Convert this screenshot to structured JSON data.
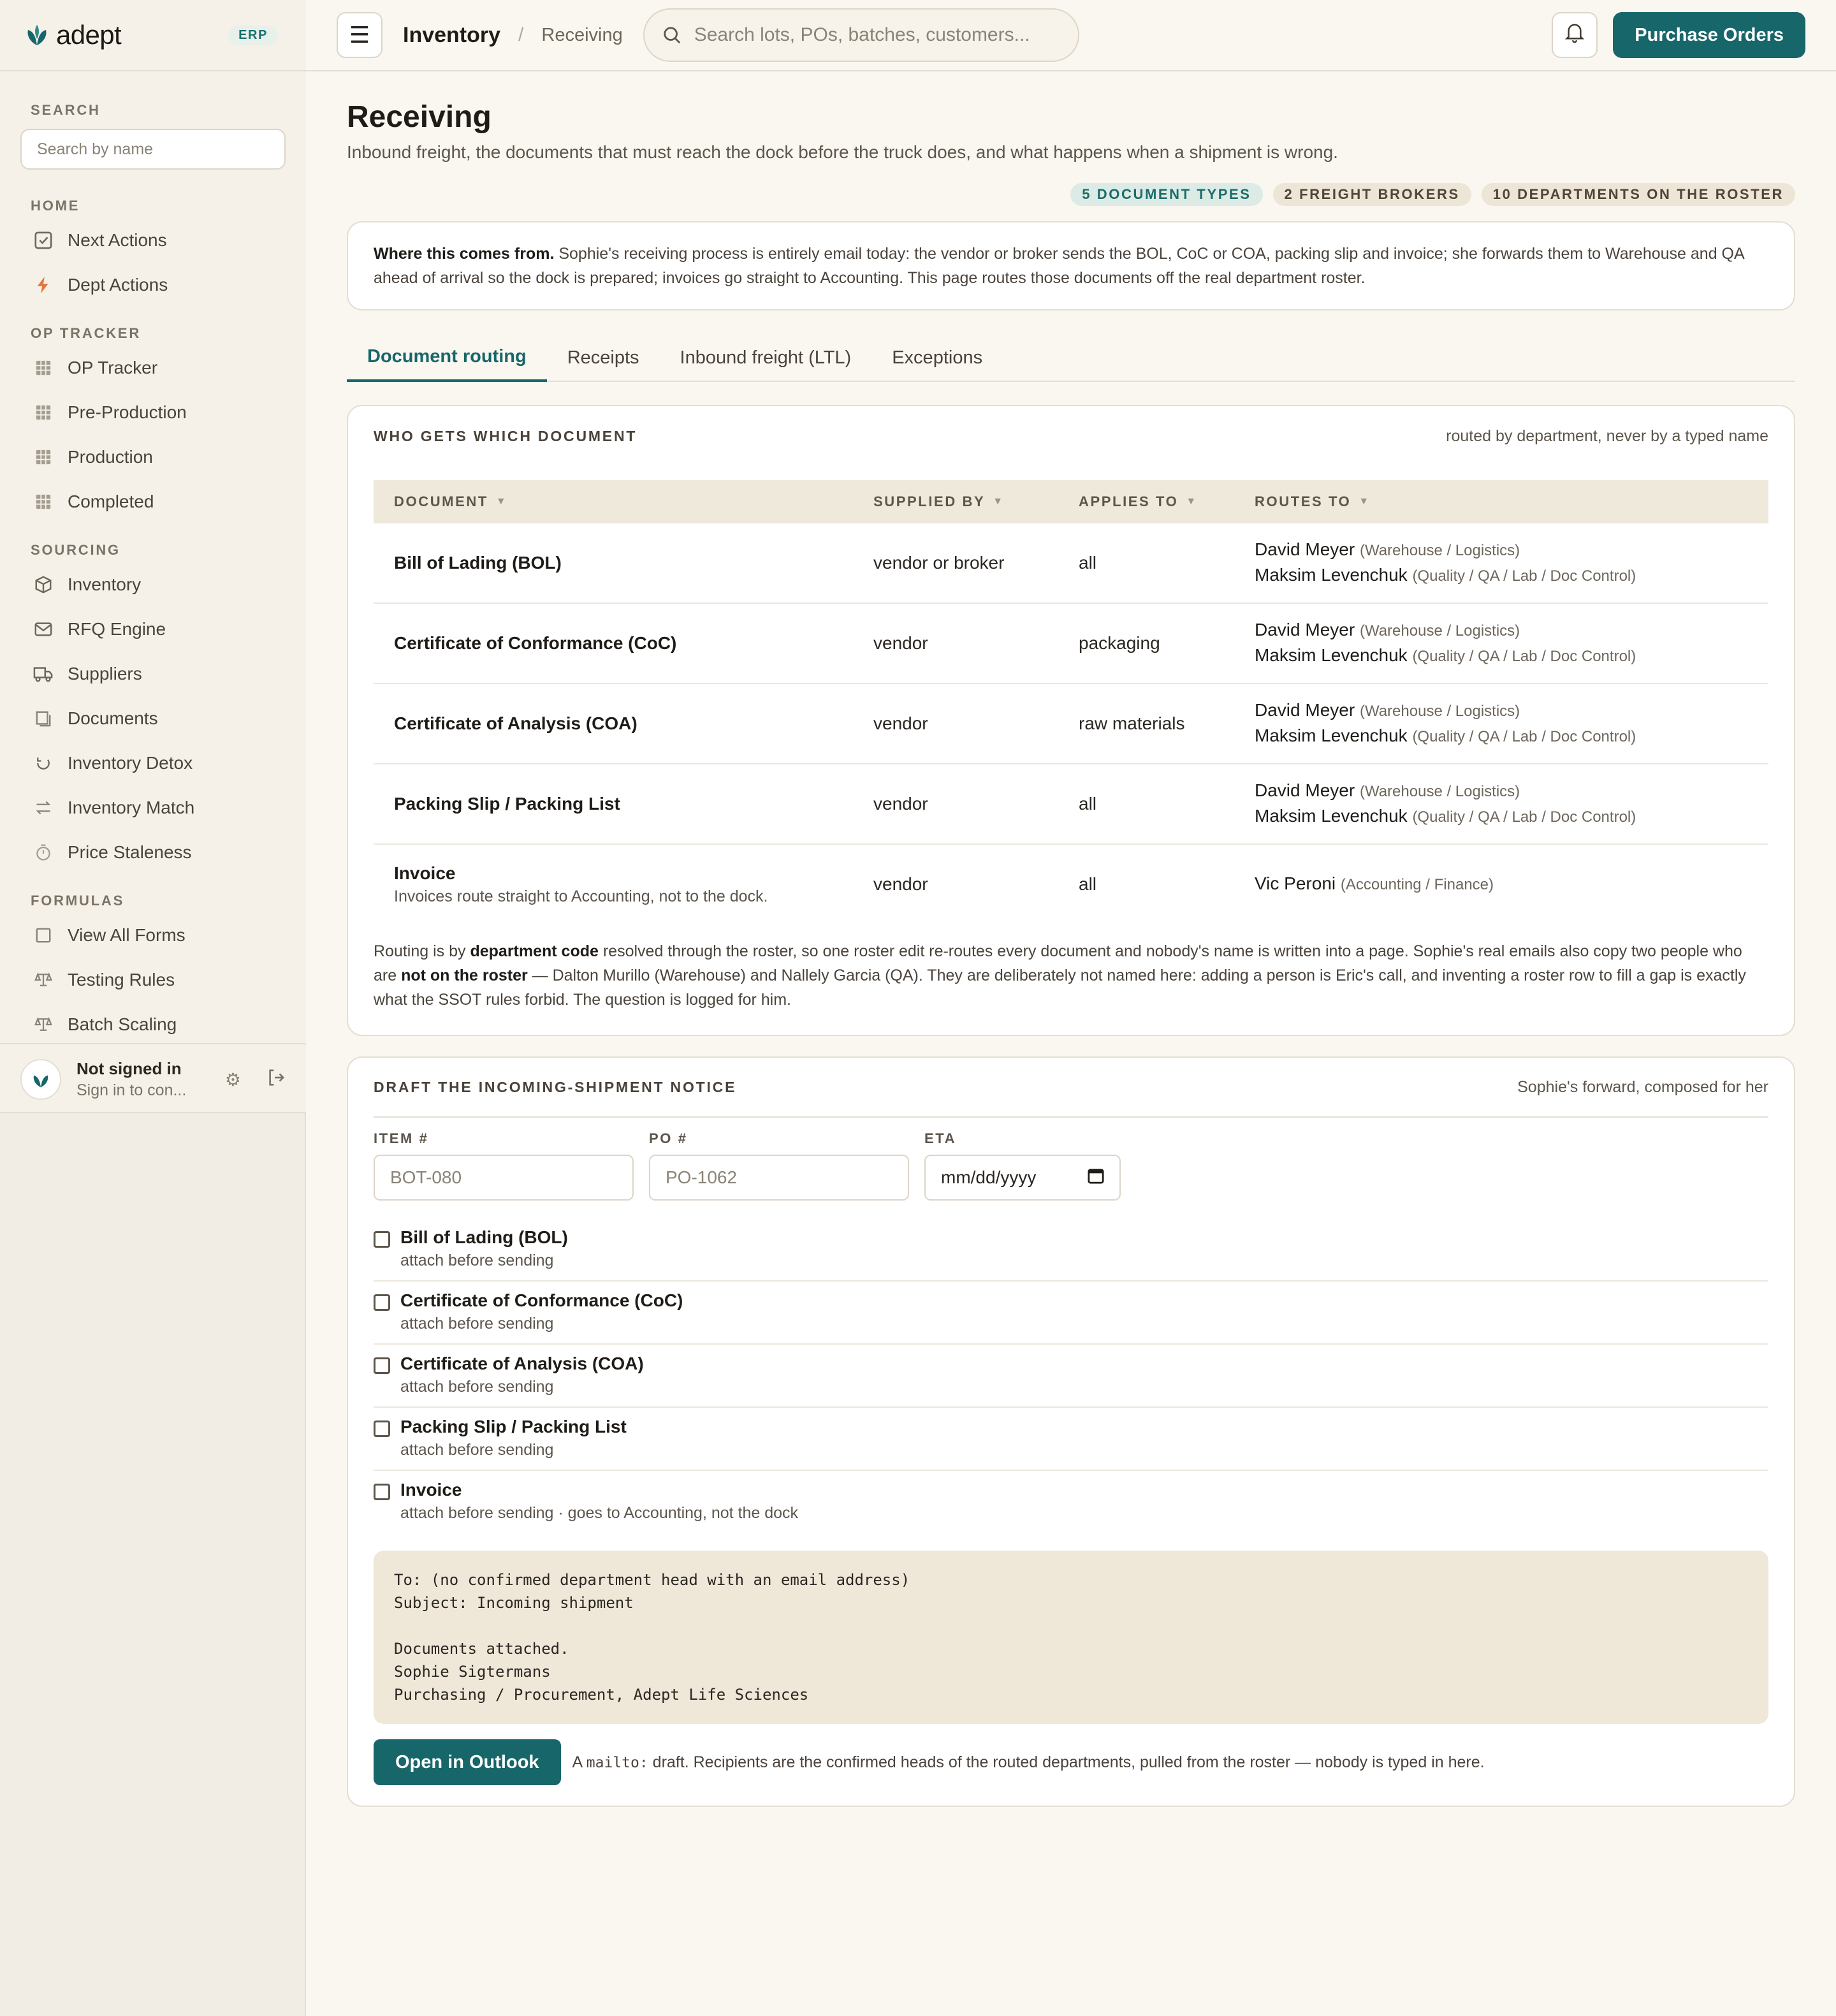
{
  "brand": {
    "name": "adept",
    "badge": "ERP"
  },
  "sidebar": {
    "search_label": "SEARCH",
    "search_placeholder": "Search by name",
    "sections": [
      {
        "label": "HOME",
        "items": [
          {
            "label": "Next Actions",
            "icon": "check-square-icon"
          },
          {
            "label": "Dept Actions",
            "icon": "bolt-icon"
          }
        ]
      },
      {
        "label": "OP TRACKER",
        "items": [
          {
            "label": "OP Tracker",
            "icon": "grid-icon"
          },
          {
            "label": "Pre-Production",
            "icon": "grid-icon"
          },
          {
            "label": "Production",
            "icon": "grid-icon"
          },
          {
            "label": "Completed",
            "icon": "grid-icon"
          }
        ]
      },
      {
        "label": "SOURCING",
        "items": [
          {
            "label": "Inventory",
            "icon": "box-icon"
          },
          {
            "label": "RFQ Engine",
            "icon": "mail-icon"
          },
          {
            "label": "Suppliers",
            "icon": "truck-icon"
          },
          {
            "label": "Documents",
            "icon": "document-icon"
          },
          {
            "label": "Inventory Detox",
            "icon": "refresh-icon"
          },
          {
            "label": "Inventory Match",
            "icon": "swap-icon"
          },
          {
            "label": "Price Staleness",
            "icon": "timer-icon"
          }
        ]
      },
      {
        "label": "FORMULAS",
        "items": [
          {
            "label": "View All Forms",
            "icon": "form-icon"
          },
          {
            "label": "Testing Rules",
            "icon": "scale-icon"
          },
          {
            "label": "Batch Scaling",
            "icon": "scale-icon"
          }
        ]
      }
    ],
    "user": {
      "name": "Not signed in",
      "sub": "Sign in to con..."
    }
  },
  "topbar": {
    "crumb_main": "Inventory",
    "crumb_sep": "/",
    "crumb_sub": "Receiving",
    "search_placeholder": "Search lots, POs, batches, customers...",
    "primary_button": "Purchase Orders"
  },
  "page": {
    "title": "Receiving",
    "subtitle": "Inbound freight, the documents that must reach the dock before the truck does, and what happens when a shipment is wrong.",
    "pills": [
      "5 DOCUMENT TYPES",
      "2 FREIGHT BROKERS",
      "10 DEPARTMENTS ON THE ROSTER"
    ],
    "origin_bold": "Where this comes from.",
    "origin_text": " Sophie's receiving process is entirely email today: the vendor or broker sends the BOL, CoC or COA, packing slip and invoice; she forwards them to Warehouse and QA ahead of arrival so the dock is prepared; invoices go straight to Accounting. This page routes those documents off the real department roster."
  },
  "tabs": [
    "Document routing",
    "Receipts",
    "Inbound freight (LTL)",
    "Exceptions"
  ],
  "routing": {
    "title": "WHO GETS WHICH DOCUMENT",
    "note": "routed by department, never by a typed name",
    "columns": [
      "DOCUMENT",
      "SUPPLIED BY",
      "APPLIES TO",
      "ROUTES TO"
    ],
    "rows": [
      {
        "document": "Bill of Lading (BOL)",
        "note": "",
        "supplied_by": "vendor or broker",
        "applies_to": "all",
        "routes": [
          {
            "name": "David Meyer",
            "dept": "(Warehouse / Logistics)"
          },
          {
            "name": "Maksim Levenchuk",
            "dept": "(Quality / QA / Lab / Doc Control)"
          }
        ]
      },
      {
        "document": "Certificate of Conformance (CoC)",
        "note": "",
        "supplied_by": "vendor",
        "applies_to": "packaging",
        "routes": [
          {
            "name": "David Meyer",
            "dept": "(Warehouse / Logistics)"
          },
          {
            "name": "Maksim Levenchuk",
            "dept": "(Quality / QA / Lab / Doc Control)"
          }
        ]
      },
      {
        "document": "Certificate of Analysis (COA)",
        "note": "",
        "supplied_by": "vendor",
        "applies_to": "raw materials",
        "routes": [
          {
            "name": "David Meyer",
            "dept": "(Warehouse / Logistics)"
          },
          {
            "name": "Maksim Levenchuk",
            "dept": "(Quality / QA / Lab / Doc Control)"
          }
        ]
      },
      {
        "document": "Packing Slip / Packing List",
        "note": "",
        "supplied_by": "vendor",
        "applies_to": "all",
        "routes": [
          {
            "name": "David Meyer",
            "dept": "(Warehouse / Logistics)"
          },
          {
            "name": "Maksim Levenchuk",
            "dept": "(Quality / QA / Lab / Doc Control)"
          }
        ]
      },
      {
        "document": "Invoice",
        "note": "Invoices route straight to Accounting, not to the dock.",
        "supplied_by": "vendor",
        "applies_to": "all",
        "routes": [
          {
            "name": "Vic Peroni",
            "dept": "(Accounting / Finance)"
          }
        ]
      }
    ],
    "foot_1": "Routing is by ",
    "foot_b1": "department code",
    "foot_2": " resolved through the roster, so one roster edit re-routes every document and nobody's name is written into a page. Sophie's real emails also copy two people who are ",
    "foot_b2": "not on the roster",
    "foot_3": " — Dalton Murillo (Warehouse) and Nallely Garcia (QA). They are deliberately not named here: adding a person is Eric's call, and inventing a roster row to fill a gap is exactly what the SSOT rules forbid. The question is logged for him."
  },
  "draft": {
    "title": "DRAFT THE INCOMING-SHIPMENT NOTICE",
    "note": "Sophie's forward, composed for her",
    "item_label": "ITEM #",
    "item_placeholder": "BOT-080",
    "po_label": "PO #",
    "po_placeholder": "PO-1062",
    "eta_label": "ETA",
    "eta_value": "mm/dd/yyyy",
    "attachments": [
      {
        "title": "Bill of Lading (BOL)",
        "sub": "attach before sending"
      },
      {
        "title": "Certificate of Conformance (CoC)",
        "sub": "attach before sending"
      },
      {
        "title": "Certificate of Analysis (COA)",
        "sub": "attach before sending"
      },
      {
        "title": "Packing Slip / Packing List",
        "sub": "attach before sending"
      },
      {
        "title": "Invoice",
        "sub": "attach before sending · goes to Accounting, not the dock"
      }
    ],
    "mail_preview": "To: (no confirmed department head with an email address)\nSubject: Incoming shipment\n\nDocuments attached.\nSophie Sigtermans\nPurchasing / Procurement, Adept Life Sciences",
    "button": "Open in Outlook",
    "send_note_pre": "A ",
    "send_note_code": "mailto:",
    "send_note_post": " draft. Recipients are the confirmed heads of the routed departments, pulled from the roster — nobody is typed in here."
  }
}
